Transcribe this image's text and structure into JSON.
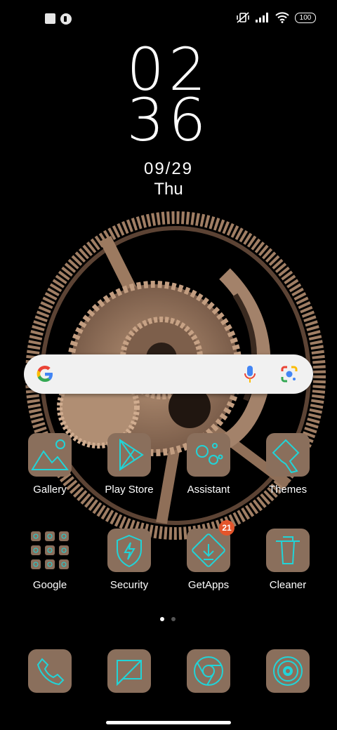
{
  "status_bar": {
    "battery": "100",
    "icons": [
      "square-notification-icon",
      "app-notification-icon",
      "vibrate-off-icon",
      "signal-icon",
      "wifi-icon",
      "battery-icon"
    ]
  },
  "clock": {
    "hours": "02",
    "minutes": "36",
    "date": "09/29",
    "day": "Thu"
  },
  "search_bar": {
    "icons": [
      "google-g-icon",
      "microphone-icon",
      "google-lens-icon"
    ]
  },
  "apps_row1": [
    {
      "label": "Gallery",
      "icon": "gallery-icon"
    },
    {
      "label": "Play Store",
      "icon": "play-store-icon"
    },
    {
      "label": "Assistant",
      "icon": "assistant-icon"
    },
    {
      "label": "Themes",
      "icon": "themes-icon"
    }
  ],
  "apps_row2": [
    {
      "label": "Google",
      "icon": "google-folder-icon"
    },
    {
      "label": "Security",
      "icon": "security-icon"
    },
    {
      "label": "GetApps",
      "icon": "getapps-icon",
      "badge": "21"
    },
    {
      "label": "Cleaner",
      "icon": "cleaner-icon"
    }
  ],
  "dock": [
    {
      "icon": "phone-icon"
    },
    {
      "icon": "messages-icon"
    },
    {
      "icon": "chrome-icon"
    },
    {
      "icon": "camera-icon"
    }
  ],
  "colors": {
    "icon_bg": "#8a6f5c",
    "icon_line": "#21d4d8",
    "badge": "#e4552b"
  },
  "page_indicator": {
    "pages": 2,
    "current": 1
  }
}
